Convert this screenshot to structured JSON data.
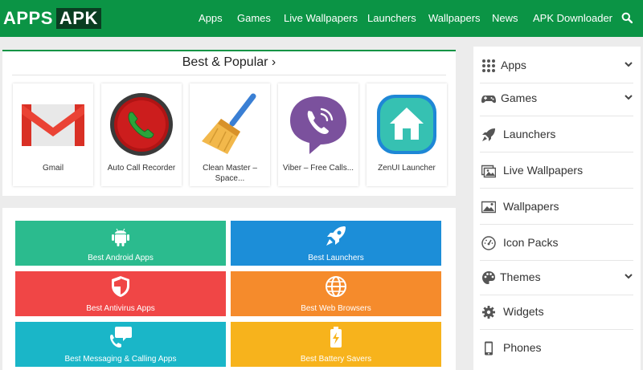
{
  "header": {
    "logo_left": "APPS",
    "logo_right": "APK",
    "nav": [
      "Apps",
      "Games",
      "Live Wallpapers",
      "Launchers",
      "Wallpapers",
      "News",
      "APK Downloader"
    ]
  },
  "popular": {
    "title": "Best & Popular ›",
    "apps": [
      {
        "name": "Gmail",
        "icon": "gmail-icon"
      },
      {
        "name": "Auto Call Recorder",
        "icon": "call-recorder-icon"
      },
      {
        "name": "Clean Master –\nSpace...",
        "icon": "broom-icon"
      },
      {
        "name": "Viber – Free Calls...",
        "icon": "viber-icon"
      },
      {
        "name": "ZenUI Launcher",
        "icon": "home-icon"
      }
    ]
  },
  "categories": [
    {
      "label": "Best Android Apps",
      "color": "#2bbb8e",
      "icon": "android-icon"
    },
    {
      "label": "Best Launchers",
      "color": "#1c8ed8",
      "icon": "rocket-icon"
    },
    {
      "label": "Best Antivirus Apps",
      "color": "#f04646",
      "icon": "shield-icon"
    },
    {
      "label": "Best Web Browsers",
      "color": "#f58b2c",
      "icon": "globe-icon"
    },
    {
      "label": "Best Messaging & Calling Apps",
      "color": "#1ab6c8",
      "icon": "chat-phone-icon"
    },
    {
      "label": "Best Battery Savers",
      "color": "#f7b31c",
      "icon": "battery-icon"
    }
  ],
  "sidebar": {
    "items": [
      {
        "label": "Apps",
        "icon": "grid-icon",
        "expandable": true
      },
      {
        "label": "Games",
        "icon": "gamepad-icon",
        "expandable": true
      },
      {
        "label": "Launchers",
        "icon": "rocket-icon",
        "expandable": false
      },
      {
        "label": "Live Wallpapers",
        "icon": "images-icon",
        "expandable": false
      },
      {
        "label": "Wallpapers",
        "icon": "picture-icon",
        "expandable": false
      },
      {
        "label": "Icon Packs",
        "icon": "dashboard-icon",
        "expandable": false
      },
      {
        "label": "Themes",
        "icon": "palette-icon",
        "expandable": true
      },
      {
        "label": "Widgets",
        "icon": "gear-icon",
        "expandable": false
      },
      {
        "label": "Phones",
        "icon": "phone-icon",
        "expandable": false
      }
    ]
  },
  "colors": {
    "brand_green": "#0b9445",
    "logo_dark": "#0a3d21"
  }
}
